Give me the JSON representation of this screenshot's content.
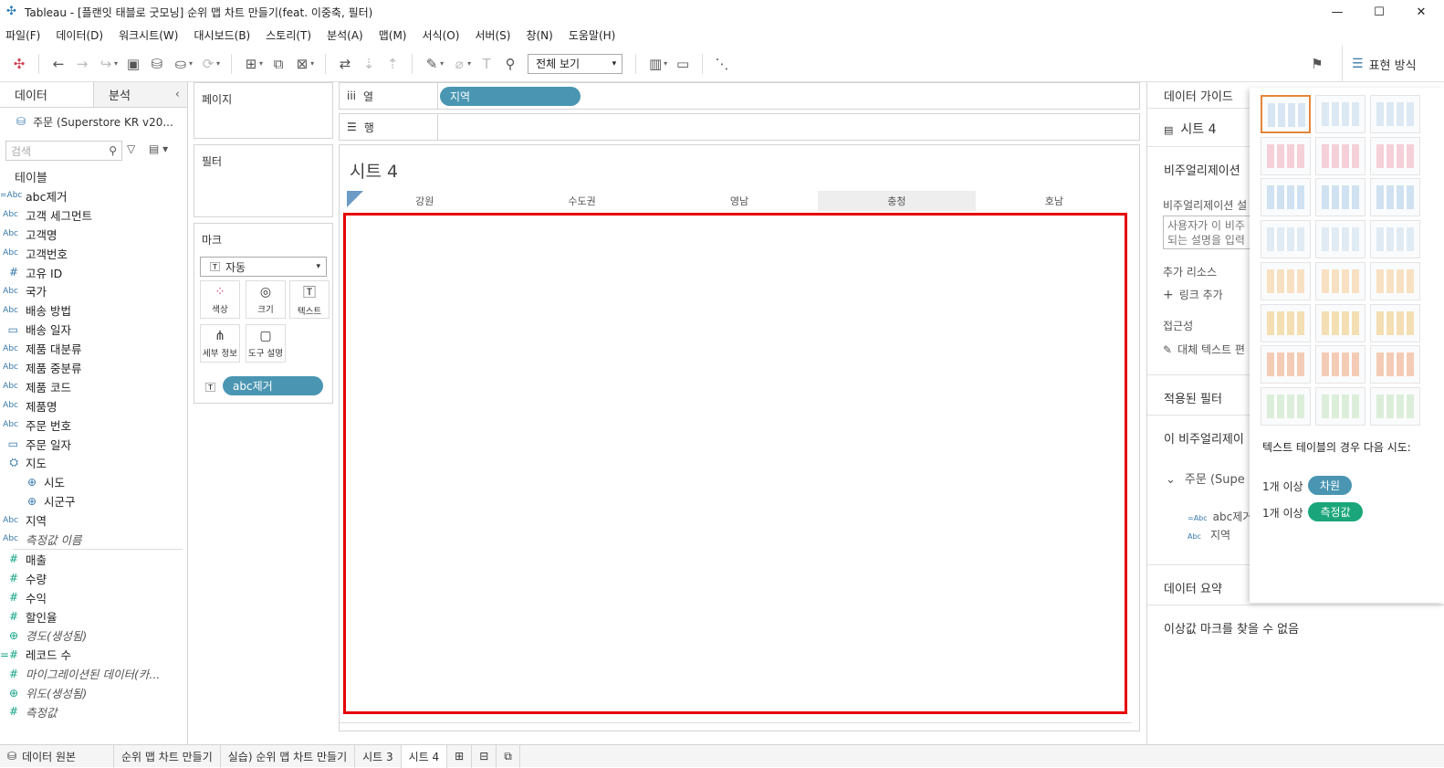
{
  "window": {
    "title": "Tableau - [플랜잇 태블로 굿모닝] 순위 맵 차트 만들기(feat. 이중축, 필터)"
  },
  "menu": [
    "파일(F)",
    "데이터(D)",
    "워크시트(W)",
    "대시보드(B)",
    "스토리(T)",
    "분석(A)",
    "맵(M)",
    "서식(O)",
    "서버(S)",
    "창(N)",
    "도움말(H)"
  ],
  "toolbar": {
    "view_select": "전체 보기",
    "show_me_label": "표현 방식"
  },
  "data_pane": {
    "tab_data": "데이터",
    "tab_analysis": "분석",
    "datasource": "주문 (Superstore KR v20...",
    "search_placeholder": "검색",
    "tables_header": "테이블",
    "fields": [
      {
        "icon": "=Abc",
        "name": "abc제거"
      },
      {
        "icon": "Abc",
        "name": "고객 세그먼트"
      },
      {
        "icon": "Abc",
        "name": "고객명"
      },
      {
        "icon": "Abc",
        "name": "고객번호"
      },
      {
        "icon": "#",
        "name": "고유 ID"
      },
      {
        "icon": "Abc",
        "name": "국가"
      },
      {
        "icon": "Abc",
        "name": "배송 방법"
      },
      {
        "icon": "▭",
        "name": "배송 일자"
      },
      {
        "icon": "Abc",
        "name": "제품 대분류"
      },
      {
        "icon": "Abc",
        "name": "제품 중분류"
      },
      {
        "icon": "Abc",
        "name": "제품 코드"
      },
      {
        "icon": "Abc",
        "name": "제품명"
      },
      {
        "icon": "Abc",
        "name": "주문 번호"
      },
      {
        "icon": "▭",
        "name": "주문 일자"
      },
      {
        "icon": "⛭",
        "name": "지도"
      },
      {
        "icon": "⊕",
        "name": "시도"
      },
      {
        "icon": "⊕",
        "name": "시군구"
      },
      {
        "icon": "Abc",
        "name": "지역"
      },
      {
        "icon": "Abc",
        "name": "측정값 이름"
      }
    ],
    "measures": [
      {
        "icon": "#",
        "name": "매출"
      },
      {
        "icon": "#",
        "name": "수량"
      },
      {
        "icon": "#",
        "name": "수익"
      },
      {
        "icon": "#",
        "name": "할인율"
      },
      {
        "icon": "⊕",
        "name": "경도(생성됨)"
      },
      {
        "icon": "=#",
        "name": "레코드 수"
      },
      {
        "icon": "#",
        "name": "마이그레이션된 데이터(카..."
      },
      {
        "icon": "⊕",
        "name": "위도(생성됨)"
      },
      {
        "icon": "#",
        "name": "측정값"
      }
    ]
  },
  "shelves": {
    "pages": "페이지",
    "filters": "필터",
    "marks": "마크",
    "mark_type": "자동",
    "mark_buttons": [
      "색상",
      "크기",
      "텍스트",
      "세부 정보",
      "도구 설명"
    ],
    "mark_pill": "abc제거",
    "columns_label": "열",
    "columns_pill": "지역",
    "rows_label": "행"
  },
  "sheet": {
    "title": "시트 4",
    "column_headers": [
      "강원",
      "수도권",
      "영남",
      "충청",
      "호남"
    ]
  },
  "guide": {
    "title": "데이터 가이드",
    "sheet": "시트 4",
    "viz_desc_header": "비주얼리제이션",
    "viz_desc_label": "비주얼리제이션 설",
    "viz_desc_placeholder1": "사용자가 이 비주",
    "viz_desc_placeholder2": "되는 설명을 입력",
    "resources": "추가 리소스",
    "add_link": "링크 추가",
    "accessibility": "접근성",
    "alt_text": "대체 텍스트 편",
    "applied_filters": "적용된 필터",
    "viz_data": "이 비주얼리제이",
    "source": "주문 (Supe",
    "src_field1": "abc제거",
    "src_field2": "지역",
    "data_summary": "데이터 요약",
    "outliers": "이상값 마크를 찾을 수 없음"
  },
  "show_me": {
    "hint": "텍스트 테이블의 경우 다음 시도:",
    "req1_prefix": "1개 이상",
    "req1_badge": "차원",
    "req2_prefix": "1개 이상",
    "req2_badge": "측정값",
    "colors": {
      "dimension": "#4a96b2",
      "measure": "#1aa67a",
      "selected": "#e5863a"
    }
  },
  "bottom_tabs": [
    "데이터 원본",
    "순위 맵 차트 만들기",
    "실습) 순위 맵 차트 만들기",
    "시트 3",
    "시트 4"
  ]
}
